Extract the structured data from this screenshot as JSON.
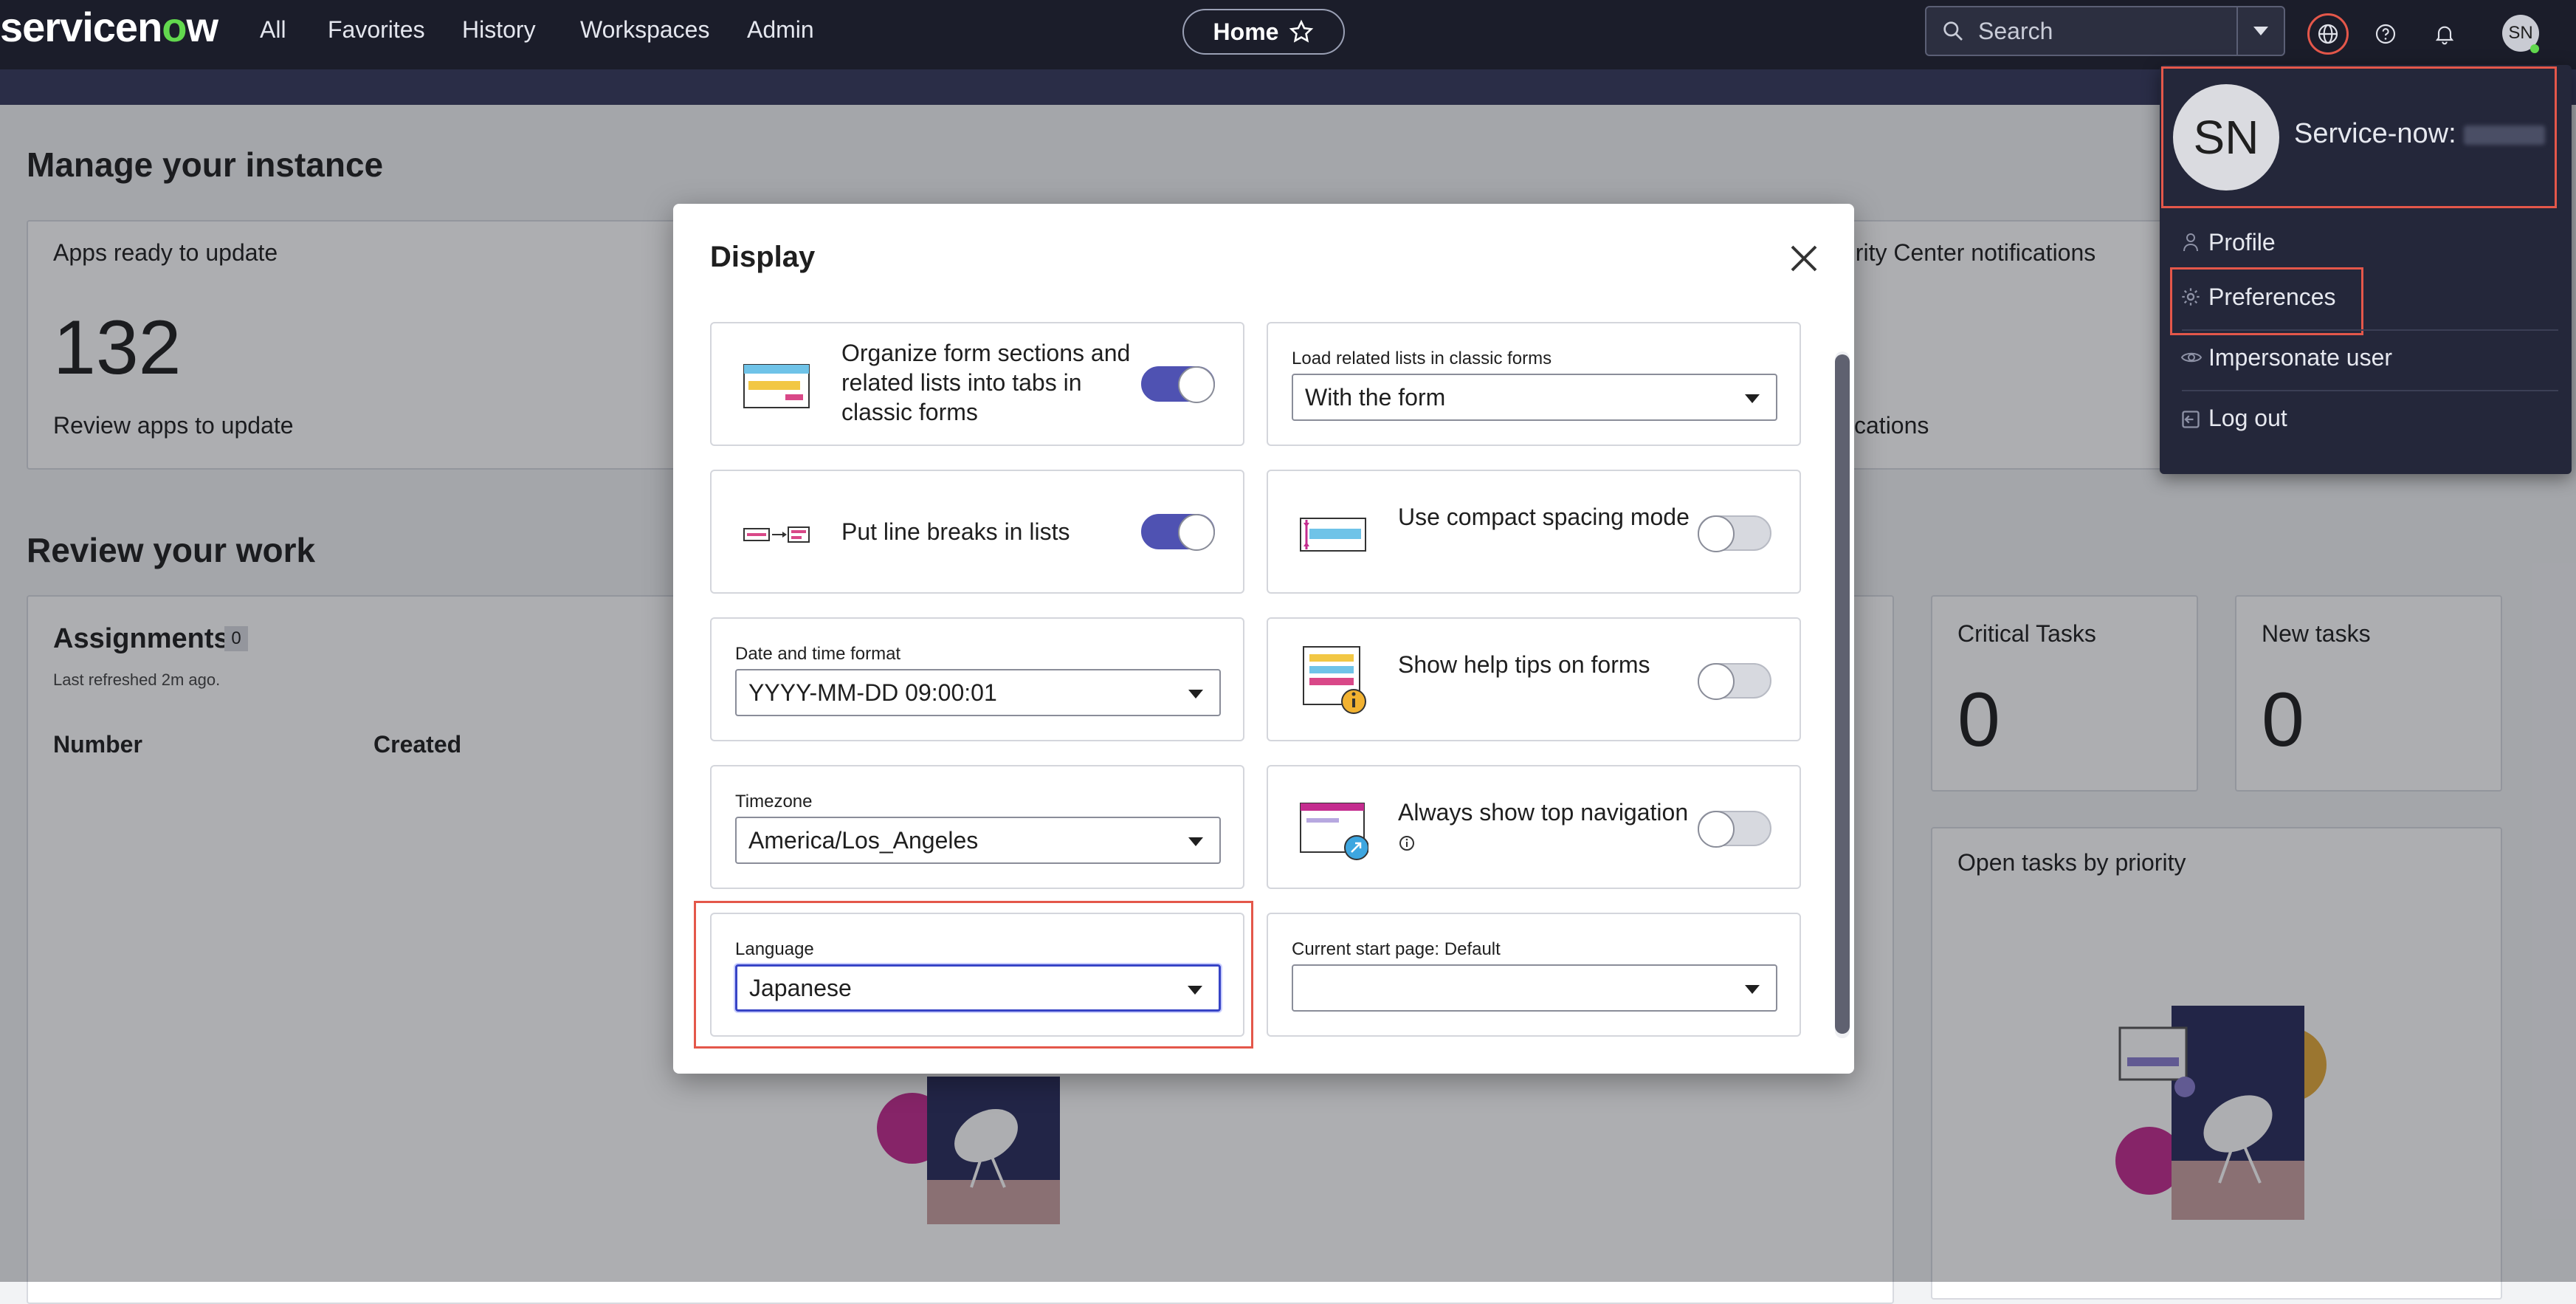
{
  "nav": {
    "logo_prefix": "servicen",
    "logo_o": "o",
    "logo_suffix": "w",
    "items": [
      "All",
      "Favorites",
      "History",
      "Workspaces",
      "Admin"
    ],
    "home_label": "Home",
    "search_placeholder": "Search",
    "avatar_initials": "SN"
  },
  "page": {
    "manage_title": "Manage your instance",
    "apps_card": {
      "title": "Apps ready to update",
      "count": "132",
      "link": "Review apps to update"
    },
    "security_card": {
      "title_partial": "urity Center notifications",
      "link_partial": "fications"
    },
    "review_title": "Review your work",
    "assignments": {
      "title": "Assignments",
      "badge": "0",
      "refreshed": "Last refreshed 2m ago.",
      "col_number": "Number",
      "col_created": "Created"
    },
    "critical": {
      "title": "Critical Tasks",
      "count": "0"
    },
    "new_tasks": {
      "title": "New tasks",
      "count": "0"
    },
    "open_tasks": {
      "title": "Open tasks by priority"
    }
  },
  "modal": {
    "title": "Display",
    "cards": {
      "tabs": {
        "text": "Organize form sections and related lists into tabs in classic forms",
        "enabled": true
      },
      "load_related": {
        "label": "Load related lists in classic forms",
        "value": "With the form"
      },
      "line_breaks": {
        "text": "Put line breaks in lists",
        "enabled": true
      },
      "compact": {
        "text": "Use compact spacing mode",
        "enabled": false
      },
      "date_format": {
        "label": "Date and time format",
        "value": "YYYY-MM-DD 09:00:01"
      },
      "help_tips": {
        "text": "Show help tips on forms",
        "enabled": false
      },
      "timezone": {
        "label": "Timezone",
        "value": "America/Los_Angeles"
      },
      "top_nav": {
        "text": "Always show top navigation",
        "enabled": false
      },
      "language": {
        "label": "Language",
        "value": "Japanese"
      },
      "start_page": {
        "label": "Current start page: Default",
        "value": ""
      }
    }
  },
  "user_menu": {
    "initials": "SN",
    "name": "Service-now: ",
    "items": [
      "Profile",
      "Preferences",
      "Impersonate user",
      "Log out"
    ]
  },
  "colors": {
    "accent": "#4f52b2",
    "highlight": "#e4574a",
    "nav_bg": "#1b1d2a",
    "logo_green": "#62d84e"
  }
}
